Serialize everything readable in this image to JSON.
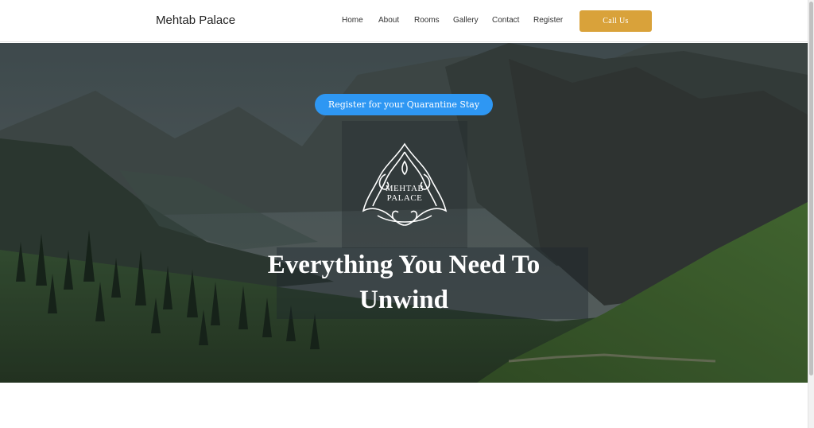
{
  "header": {
    "brand": "Mehtab Palace",
    "nav": [
      "Home",
      "About",
      "Rooms",
      "Gallery",
      "Contact",
      "Register"
    ],
    "cta": "Call Us"
  },
  "hero": {
    "register_button": "Register for your Quarantine Stay",
    "logo_line1": "MEHTAB",
    "logo_line2": "PALACE",
    "headline_line1": "Everything You Need To",
    "headline_line2": "Unwind"
  },
  "icons": {
    "logo": "ornamental-palace-emblem",
    "background": "mountain-valley-photo"
  },
  "colors": {
    "cta": "#d9a23a",
    "register_button": "#2e97f3",
    "hero_overlay": "#1e242c"
  }
}
